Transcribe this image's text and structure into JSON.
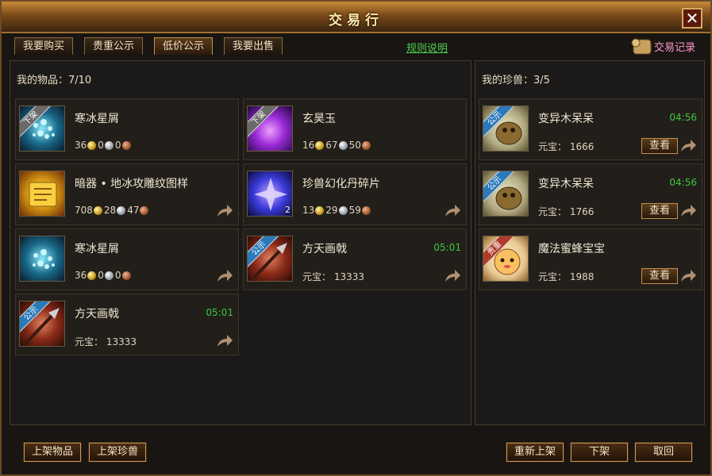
{
  "window": {
    "title": "交易行",
    "close_label": "✕"
  },
  "tabs": [
    {
      "label": "我要购买"
    },
    {
      "label": "贵重公示"
    },
    {
      "label": "低价公示"
    },
    {
      "label": "我要出售"
    }
  ],
  "rules_link": "规则说明",
  "trade_log": "交易记录",
  "items_panel": {
    "header": "我的物品：7/10",
    "items": [
      {
        "name": "寒冰星屑",
        "badge": "下架",
        "price": {
          "gold": "36",
          "silver": "0",
          "copper": "0"
        }
      },
      {
        "name": "玄昊玉",
        "badge": "下架",
        "price": {
          "gold": "16",
          "silver": "67",
          "copper": "50"
        }
      },
      {
        "name": "暗器 • 地冰攻雕纹图样",
        "price": {
          "gold": "708",
          "silver": "28",
          "copper": "47"
        }
      },
      {
        "name": "珍兽幻化丹碎片",
        "count": "2",
        "price": {
          "gold": "13",
          "silver": "29",
          "copper": "59"
        }
      },
      {
        "name": "寒冰星屑",
        "price": {
          "gold": "36",
          "silver": "0",
          "copper": "0"
        }
      },
      {
        "name": "方天画戟",
        "badge": "公示",
        "timer": "05:01",
        "yuanbao": "元宝： 13333"
      },
      {
        "name": "方天画戟",
        "badge": "公示",
        "timer": "05:01",
        "yuanbao": "元宝： 13333"
      }
    ]
  },
  "pets_panel": {
    "header": "我的珍兽：3/5",
    "pets": [
      {
        "name": "变异木呆呆",
        "badge": "公示",
        "timer": "04:56",
        "yuanbao": "元宝： 1666",
        "view_label": "查看"
      },
      {
        "name": "变异木呆呆",
        "badge": "公示",
        "timer": "04:56",
        "yuanbao": "元宝： 1766",
        "view_label": "查看"
      },
      {
        "name": "魔法蜜蜂宝宝",
        "badge": "贵重",
        "yuanbao": "元宝： 1988",
        "view_label": "查看"
      }
    ]
  },
  "buttons": {
    "list_item": "上架物品",
    "list_pet": "上架珍兽",
    "relist": "重新上架",
    "delist": "下架",
    "cancel": "取回"
  },
  "colors": {
    "timer": "#3ec83e",
    "rules_link": "#4fd04f",
    "trade_log": "#ff9ad0",
    "frame": "#c89a58"
  }
}
